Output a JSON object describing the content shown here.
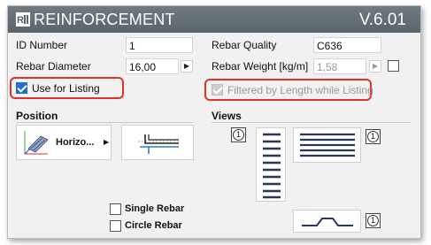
{
  "header": {
    "title": "REINFORCEMENT",
    "version": "V.6.01"
  },
  "fields": {
    "id_number": {
      "label": "ID Number",
      "value": "1"
    },
    "rebar_diameter": {
      "label": "Rebar Diameter",
      "value": "16,00"
    },
    "rebar_quality": {
      "label": "Rebar Quality",
      "value": "C636"
    },
    "rebar_weight": {
      "label": "Rebar Weight [kg/m]",
      "value": "1,58"
    }
  },
  "checkboxes": {
    "use_for_listing": {
      "label": "Use for Listing",
      "checked": true
    },
    "filtered_by_length": {
      "label": "Filtered by Length while Listing",
      "checked": true,
      "disabled": true
    },
    "single_rebar": {
      "label": "Single Rebar",
      "checked": false
    },
    "circle_rebar": {
      "label": "Circle Rebar",
      "checked": false
    }
  },
  "position": {
    "header": "Position",
    "option_label": "Horizo..."
  },
  "views": {
    "header": "Views",
    "badge": "1"
  },
  "colors": {
    "title_bar": "#5f6a71",
    "highlight": "#e0312c",
    "accent": "#1e6fd1"
  }
}
